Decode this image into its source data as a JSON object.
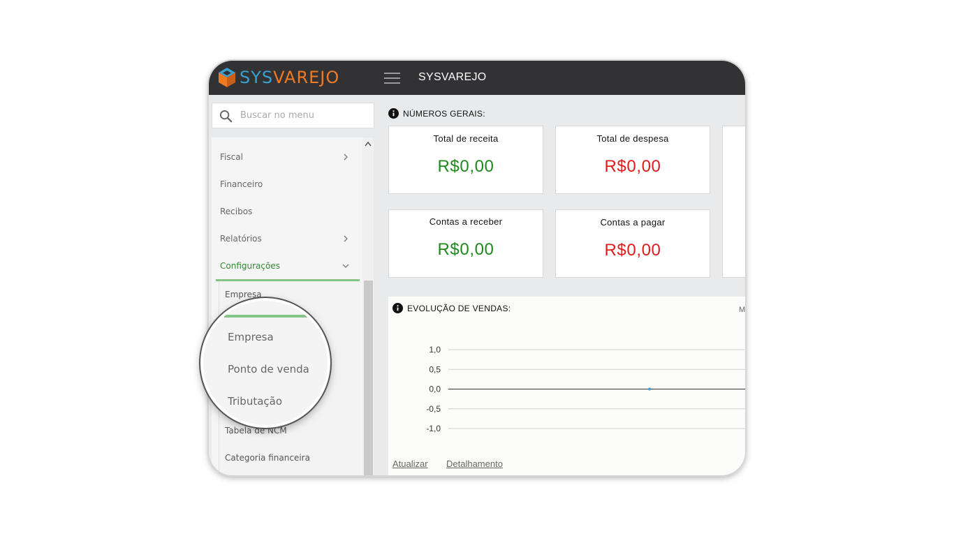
{
  "app": {
    "logo_sys": "SYS",
    "logo_varejo": "VAREJO",
    "title": "SYSVAREJO"
  },
  "sidebar": {
    "search_placeholder": "Buscar no menu",
    "items": [
      {
        "label": "Fiscal",
        "has_submenu": true
      },
      {
        "label": "Financeiro",
        "has_submenu": false
      },
      {
        "label": "Recibos",
        "has_submenu": false
      },
      {
        "label": "Relatórios",
        "has_submenu": true
      },
      {
        "label": "Configurações",
        "has_submenu": true,
        "expanded": true
      }
    ],
    "submenu": [
      "Empresa",
      "Tabela de NCM",
      "Categoria financeira"
    ]
  },
  "magnifier": {
    "items": [
      "Empresa",
      "Ponto de venda",
      "Tributação"
    ]
  },
  "main": {
    "numbers_title": "NÚMEROS GERAIS:",
    "cards": [
      {
        "title": "Total de receita",
        "value": "R$0,00",
        "color": "#1e8a1e"
      },
      {
        "title": "Total de despesa",
        "value": "R$0,00",
        "color": "#e01b1b"
      },
      {
        "title": "Contas a receber",
        "value": "R$0,00",
        "color": "#1e8a1e"
      },
      {
        "title": "Contas a pagar",
        "value": "R$0,00",
        "color": "#e01b1b"
      }
    ],
    "sales_title": "EVOLUÇÃO DE VENDAS:",
    "sales_corner": "M",
    "links": {
      "update": "Atualizar",
      "details": "Detalhamento"
    }
  },
  "chart_data": {
    "type": "line",
    "y_ticks": [
      "1,0",
      "0,5",
      "0,0",
      "-0,5",
      "-1,0"
    ],
    "ylim": [
      -1.0,
      1.0
    ],
    "grid": true,
    "series": [
      {
        "values": [
          0
        ]
      }
    ]
  },
  "colors": {
    "topbar": "#323234",
    "logo_sys": "#3aa0cf",
    "logo_varejo": "#ef7a24",
    "active_green": "#86c386",
    "positive": "#1e8a1e",
    "negative": "#e01b1b"
  }
}
